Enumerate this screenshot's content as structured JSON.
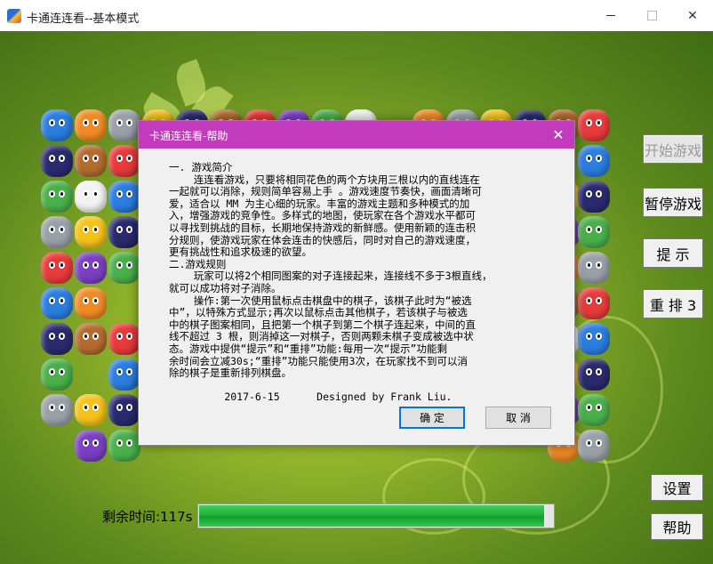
{
  "window": {
    "title": "卡通连连看--基本模式",
    "minimize": "—",
    "close": "✕"
  },
  "sidebar": {
    "start": "开始游戏",
    "pause": "暂停游戏",
    "hint": "提  示",
    "shuffle": "重 排 3",
    "settings": "设置",
    "help": "帮助"
  },
  "status": {
    "time_label": "剩余时间:117s",
    "time_fraction": 0.975
  },
  "colors": {
    "dialog_title_bg": "#c23bbd",
    "progress_green": "#20b03a",
    "background_green": "#8fb22a"
  },
  "help_dialog": {
    "title": "卡通连连看-帮助",
    "close": "✕",
    "body": "一. 游戏简介\n    连连看游戏，只要将相同花色的两个方块用三根以内的直线连在\n一起就可以消除，规则简单容易上手 。游戏速度节奏快，画面清晰可\n爱，适合以 MM 为主心细的玩家。丰富的游戏主题和多种模式的加\n入，增强游戏的竞争性。多样式的地图，使玩家在各个游戏水平都可\n以寻找到挑战的目标，长期地保持游戏的新鲜感。使用新颖的连击积\n分规则，使游戏玩家在体会连击的快感后，同时对自己的游戏速度，\n更有挑战性和追求极速的欲望。\n二.游戏规则\n    玩家可以将2个相同图案的对子连接起来，连接线不多于3根直线，\n就可以成功将对子消除。\n    操作:第一次使用鼠标点击棋盘中的棋子，该棋子此时为“被选\n中”，以特殊方式显示;再次以鼠标点击其他棋子，若该棋子与被选\n中的棋子图案相同，且把第一个棋子到第二个棋子连起来，中间的直\n线不超过 3 根，则消掉这一对棋子，否则两颗未棋子变成被选中状\n态。游戏中提供“提示”和“重排”功能:每用一次“提示”功能剩\n余时间会立减30s;“重排”功能只能使用3次，在玩家找不到可以消\n除的棋子是重新排列棋盘。\n\n         2017-6-15      Designed by Frank Liu.",
    "ok": "确  定",
    "cancel": "取 消"
  }
}
